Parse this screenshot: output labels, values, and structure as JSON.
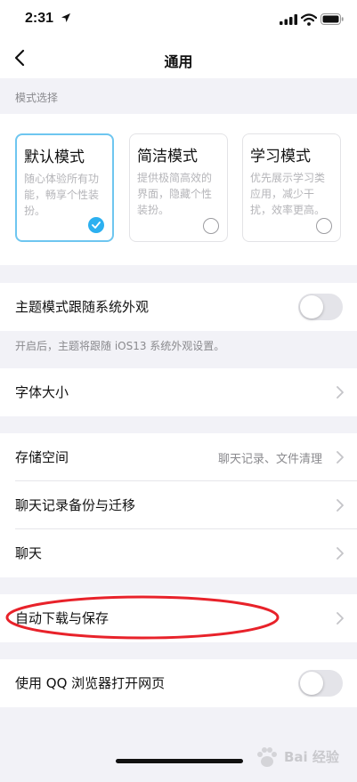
{
  "status_bar": {
    "time": "2:31"
  },
  "nav": {
    "title": "通用"
  },
  "mode_section": {
    "label": "模式选择",
    "cards": [
      {
        "title": "默认模式",
        "desc": "随心体验所有功能，畅享个性装扮。",
        "selected": true
      },
      {
        "title": "简洁模式",
        "desc": "提供极简高效的界面，隐藏个性装扮。",
        "selected": false
      },
      {
        "title": "学习模式",
        "desc": "优先展示学习类应用，减少干扰，效率更高。",
        "selected": false
      }
    ]
  },
  "theme_follow": {
    "label": "主题模式跟随系统外观",
    "enabled": false,
    "hint": "开启后，主题将跟随 iOS13 系统外观设置。"
  },
  "font_size": {
    "label": "字体大小"
  },
  "storage": {
    "label": "存储空间",
    "value": "聊天记录、文件清理"
  },
  "backup": {
    "label": "聊天记录备份与迁移"
  },
  "chat": {
    "label": "聊天"
  },
  "auto_download": {
    "label": "自动下载与保存"
  },
  "qq_browser": {
    "label": "使用 QQ 浏览器打开网页",
    "enabled": false
  },
  "watermark": {
    "text": "Bai 经验"
  },
  "colors": {
    "accent": "#2cb0f0",
    "selected_border": "#6ec6f0",
    "annotation": "#e8222a",
    "background": "#f2f2f7"
  },
  "icons": [
    "location-arrow-icon",
    "signal-icon",
    "wifi-icon",
    "battery-icon",
    "back-chevron-icon",
    "chevron-right-icon",
    "checkmark-icon",
    "paw-logo-icon"
  ]
}
